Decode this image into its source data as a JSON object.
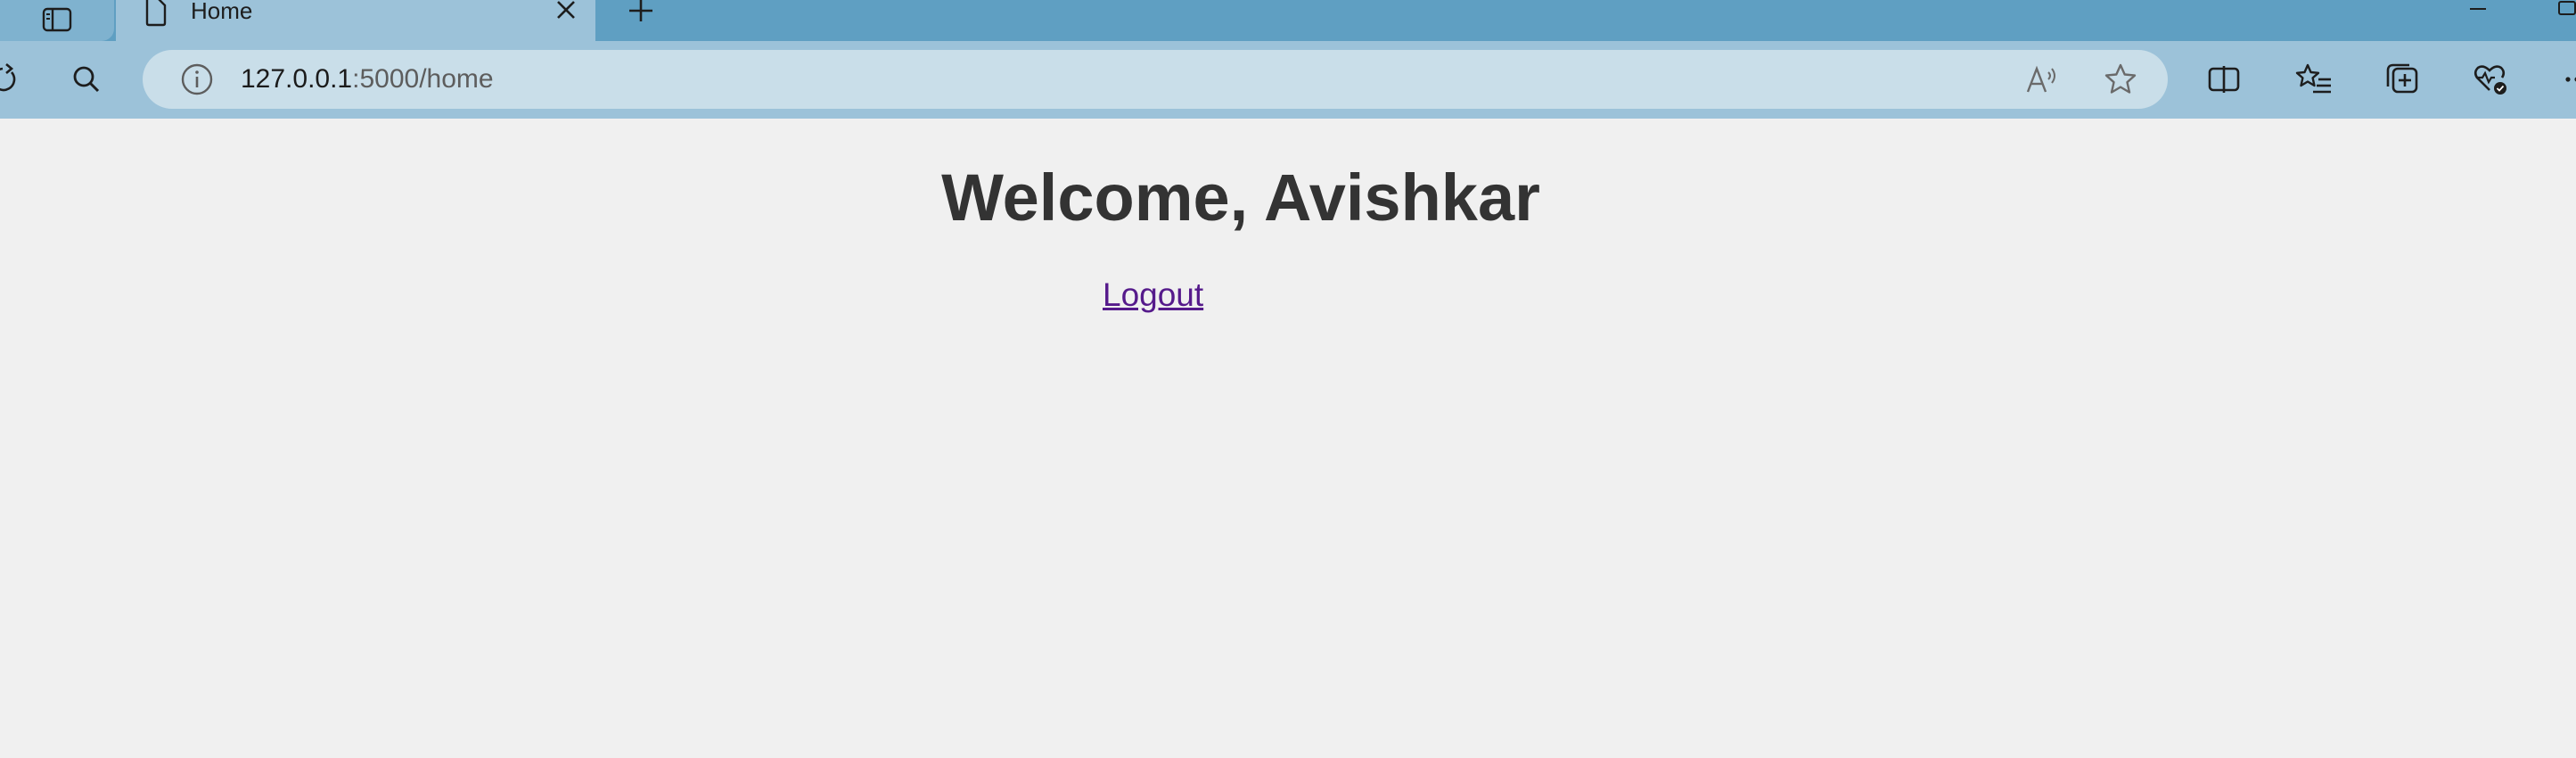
{
  "browser": {
    "tab": {
      "title": "Home",
      "close_icon": "close-icon",
      "page_icon": "page-icon"
    },
    "new_tab_icon": "plus-icon",
    "address_bar": {
      "url_host": "127.0.0.1",
      "url_rest": ":5000/home",
      "site_info_icon": "info-icon"
    },
    "toolbar_icons": [
      "sidebar-icon",
      "refresh-icon",
      "search-icon",
      "read-aloud-icon",
      "favorite-star-icon",
      "split-screen-icon",
      "favorites-icon",
      "collections-icon",
      "browser-essentials-icon",
      "more-icon"
    ],
    "colors": {
      "tab_strip": "#5f9fc2",
      "toolbar": "#9cc2d9",
      "address_bar": "#c9dee9"
    }
  },
  "page": {
    "heading": "Welcome, Avishkar",
    "logout_link": "Logout",
    "colors": {
      "background": "#f0f0f0",
      "heading": "#333333",
      "visited_link": "#551a8b"
    }
  }
}
